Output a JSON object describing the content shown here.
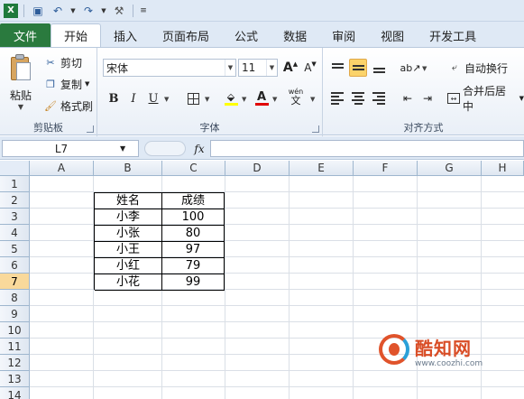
{
  "qat": {
    "save_icon": "save-icon",
    "undo_icon": "undo-icon",
    "redo_icon": "redo-icon",
    "customize_icon": "customize-icon"
  },
  "tabs": {
    "file": "文件",
    "items": [
      "开始",
      "插入",
      "页面布局",
      "公式",
      "数据",
      "审阅",
      "视图",
      "开发工具"
    ],
    "active": "开始"
  },
  "ribbon": {
    "clipboard": {
      "paste": "粘贴",
      "cut": "剪切",
      "copy": "复制",
      "format_painter": "格式刷",
      "label": "剪贴板"
    },
    "font": {
      "name": "宋体",
      "size": "11",
      "bold": "B",
      "italic": "I",
      "underline": "U",
      "label": "字体",
      "grow": "A",
      "shrink": "A",
      "wen": "wén"
    },
    "alignment": {
      "wrap": "自动换行",
      "merge": "合并后居中",
      "label": "对齐方式"
    }
  },
  "formula_bar": {
    "name_box": "L7",
    "fx": "fx",
    "formula": ""
  },
  "columns": [
    "A",
    "B",
    "C",
    "D",
    "E",
    "F",
    "G",
    "H"
  ],
  "rows": [
    "1",
    "2",
    "3",
    "4",
    "5",
    "6",
    "7",
    "8",
    "9",
    "10",
    "11",
    "12",
    "13",
    "14"
  ],
  "table": {
    "headers": [
      "姓名",
      "成绩"
    ],
    "rows": [
      [
        "小李",
        "100"
      ],
      [
        "小张",
        "80"
      ],
      [
        "小王",
        "97"
      ],
      [
        "小红",
        "79"
      ],
      [
        "小花",
        "99"
      ]
    ]
  },
  "watermark": {
    "name": "酷知网",
    "url": "www.coozhi.com"
  },
  "colors": {
    "file_tab": "#2a7a3e",
    "selected_row": "#f9d99b",
    "accent_red": "#e0532b"
  }
}
